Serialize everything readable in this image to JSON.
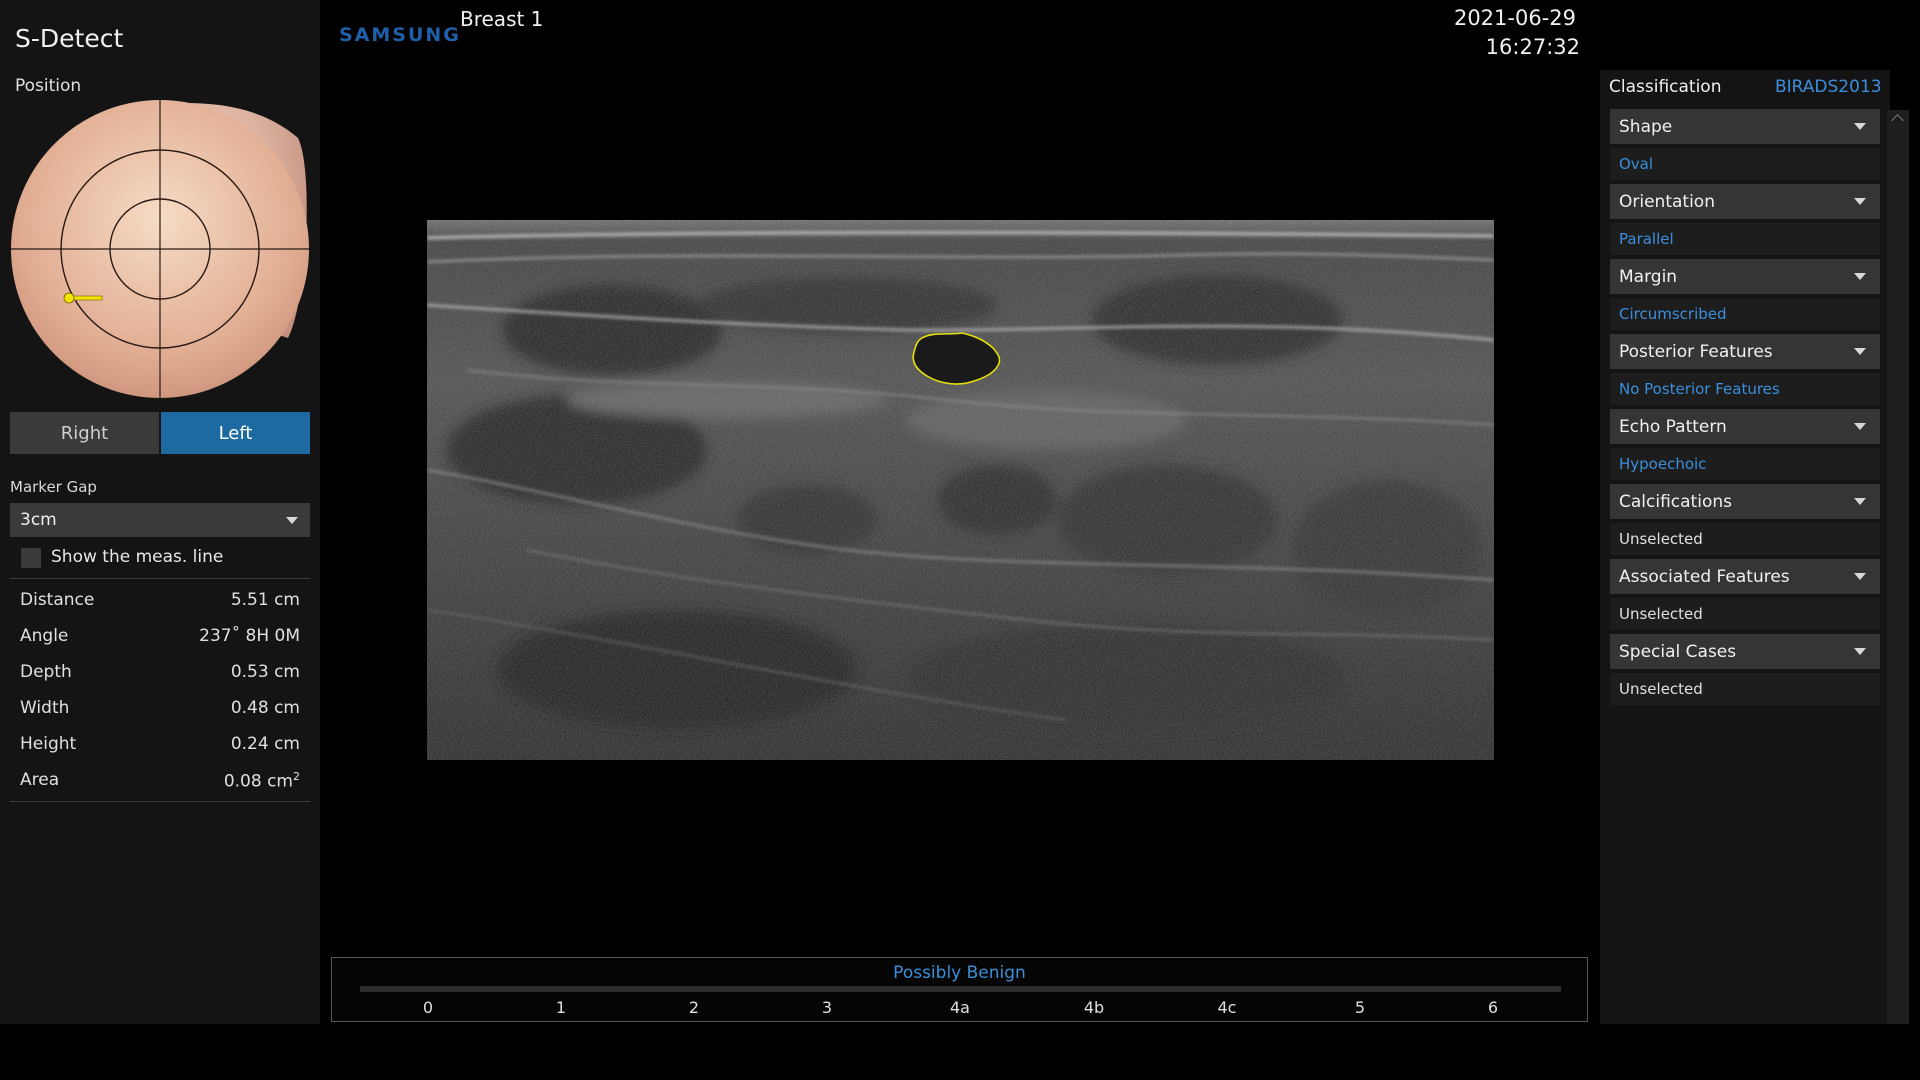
{
  "app": {
    "title": "S-Detect"
  },
  "header": {
    "brand": "SAMSUNG",
    "exam": "Breast  1",
    "date": "2021-06-29",
    "time": "16:27:32"
  },
  "left_panel": {
    "position_label": "Position",
    "side_buttons": {
      "right": "Right",
      "left": "Left",
      "selected": "Left"
    },
    "marker_gap": {
      "label": "Marker Gap",
      "value": "3cm"
    },
    "show_meas_line": {
      "label": "Show the meas. line",
      "checked": false
    },
    "measurements": [
      {
        "label": "Distance",
        "value": "5.51 cm"
      },
      {
        "label": "Angle",
        "value": "237˚ 8H 0M"
      },
      {
        "label": "Depth",
        "value": "0.53 cm"
      },
      {
        "label": "Width",
        "value": "0.48 cm"
      },
      {
        "label": "Height",
        "value": "0.24 cm"
      },
      {
        "label": "Area",
        "value": "0.08 cm",
        "unit_sup": "2"
      }
    ]
  },
  "classification": {
    "label": "Classification",
    "system": "BIRADS2013",
    "categories": [
      {
        "name": "Shape",
        "value": "Oval",
        "selected": true
      },
      {
        "name": "Orientation",
        "value": "Parallel",
        "selected": true
      },
      {
        "name": "Margin",
        "value": "Circumscribed",
        "selected": true
      },
      {
        "name": "Posterior Features",
        "value": "No Posterior Features",
        "selected": true
      },
      {
        "name": "Echo Pattern",
        "value": "Hypoechoic",
        "selected": true
      },
      {
        "name": "Calcifications",
        "value": "Unselected",
        "selected": false
      },
      {
        "name": "Associated Features",
        "value": "Unselected",
        "selected": false
      },
      {
        "name": "Special Cases",
        "value": "Unselected",
        "selected": false
      }
    ]
  },
  "result_scale": {
    "result": "Possibly Benign",
    "ticks": [
      "0",
      "1",
      "2",
      "3",
      "4a",
      "4b",
      "4c",
      "5",
      "6"
    ]
  },
  "colors": {
    "accent": "#3b8fdc",
    "selected_button": "#1d6aa0",
    "lesion_outline": "#e5e10a",
    "marker": "#f2e400"
  }
}
